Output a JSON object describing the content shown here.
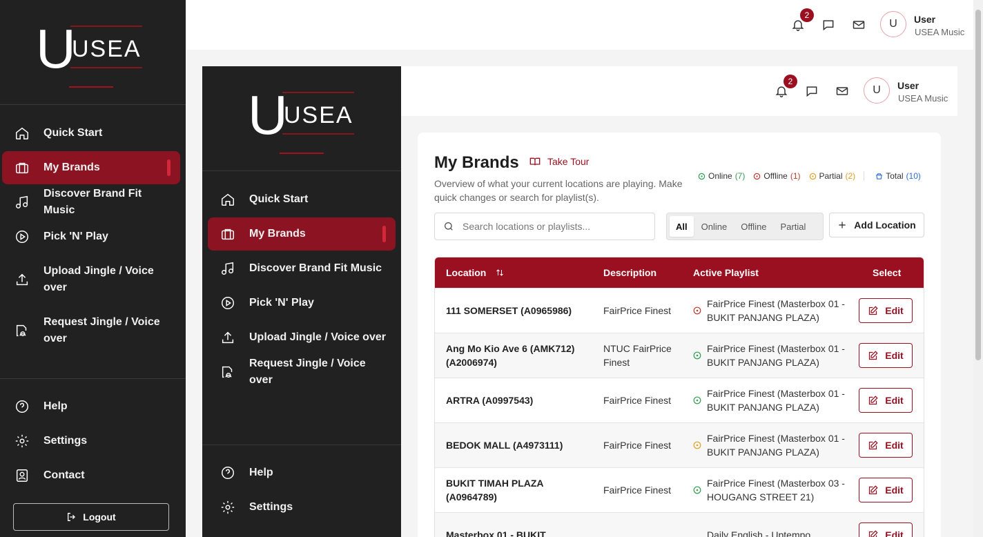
{
  "brand": {
    "logo_letter": "U",
    "logo_text": "USEA"
  },
  "sidebar": {
    "items": [
      {
        "label": "Quick Start",
        "icon": "home-icon"
      },
      {
        "label": "My Brands",
        "icon": "briefcase-icon",
        "active": true
      },
      {
        "label": "Discover Brand Fit Music",
        "icon": "music-icon"
      },
      {
        "label": "Pick 'N' Play",
        "icon": "play-circle-icon"
      },
      {
        "label": "Upload Jingle / Voice over",
        "icon": "upload-icon"
      },
      {
        "label": "Request Jingle / Voice over",
        "icon": "request-file-icon"
      }
    ],
    "bottom": [
      {
        "label": "Help",
        "icon": "help-icon"
      },
      {
        "label": "Settings",
        "icon": "gear-icon"
      },
      {
        "label": "Contact",
        "icon": "contact-icon"
      }
    ],
    "logout_label": "Logout"
  },
  "topbar": {
    "notification_count": "2",
    "user_initial": "U",
    "user_name": "User",
    "user_org": "USEA Music"
  },
  "main": {
    "title": "My Brands",
    "tour_label": "Take Tour",
    "subtitle": "Overview of what your current locations are playing. Make quick changes or search for playlist(s).",
    "stats": [
      {
        "label": "Online",
        "count": "(7)",
        "color": "#2e9e4f"
      },
      {
        "label": "Offline",
        "count": "(1)",
        "color": "#c0392b"
      },
      {
        "label": "Partial",
        "count": "(2)",
        "color": "#e0a020"
      },
      {
        "label": "Total",
        "count": "(10)",
        "color": "#2b6cd4"
      }
    ],
    "search_placeholder": "Search locations or playlists...",
    "filters": [
      "All",
      "Online",
      "Offline",
      "Partial"
    ],
    "active_filter": "All",
    "add_location_label": "Add Location",
    "table": {
      "headers": {
        "location": "Location",
        "description": "Description",
        "playlist": "Active Playlist",
        "select": "Select"
      },
      "edit_label": "Edit",
      "rows": [
        {
          "location": "111 SOMERSET (A0965986)",
          "description": "FairPrice Finest",
          "status": "offline",
          "playlist": "FairPrice Finest (Masterbox 01 - BUKIT PANJANG PLAZA)"
        },
        {
          "location": "Ang Mo Kio Ave 6 (AMK712) (A2006974)",
          "description": "NTUC FairPrice Finest",
          "status": "online",
          "playlist": "FairPrice Finest (Masterbox 01 - BUKIT PANJANG PLAZA)"
        },
        {
          "location": "ARTRA (A0997543)",
          "description": "FairPrice Finest",
          "status": "online",
          "playlist": "FairPrice Finest (Masterbox 01 - BUKIT PANJANG PLAZA)"
        },
        {
          "location": "BEDOK MALL (A4973111)",
          "description": "FairPrice Finest",
          "status": "partial",
          "playlist": "FairPrice Finest (Masterbox 01 - BUKIT PANJANG PLAZA)"
        },
        {
          "location": "BUKIT TIMAH PLAZA (A0964789)",
          "description": "FairPrice Finest",
          "status": "online",
          "playlist": "FairPrice Finest (Masterbox 03 - HOUGANG STREET 21)"
        },
        {
          "location": "Masterbox 01 - BUKIT",
          "description": "",
          "status": "",
          "playlist": "Daily English - Uptempo"
        }
      ]
    }
  },
  "colors": {
    "accent": "#9b1020",
    "sidebar_bg": "#212121",
    "online": "#2e9e4f",
    "offline": "#c0392b",
    "partial": "#e0a020"
  }
}
